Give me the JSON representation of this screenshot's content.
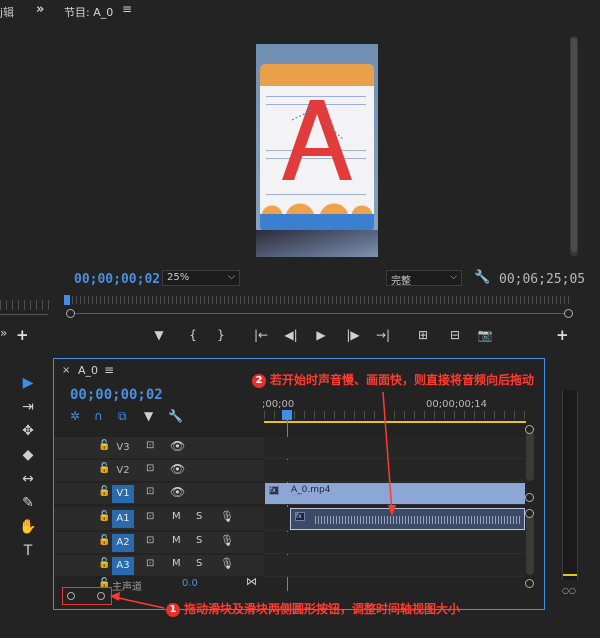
{
  "source_panel": {
    "tab_fragment": "j辑",
    "chevron": "»",
    "plus": "+",
    "chevron_small": "»"
  },
  "program_monitor": {
    "title": "节目: A_0",
    "menu_icon": "menu-icon",
    "timecode_current": "00;00;00;02",
    "zoom_select": "25%",
    "quality_select": "完整",
    "timecode_duration": "00;06;25;05",
    "controls": [
      "marker-icon",
      "in-point-icon",
      "out-point-icon",
      "go-to-in-icon",
      "step-back-icon",
      "play-icon",
      "step-forward-icon",
      "go-to-out-icon",
      "lift-icon",
      "extract-icon",
      "export-frame-icon"
    ],
    "control_glyphs": [
      "▼",
      "{",
      "}",
      "|←",
      "◀|",
      "▶",
      "|▶",
      "→|",
      "⊞",
      "⊟",
      "📷"
    ],
    "plus": "+"
  },
  "tools": [
    {
      "name": "selection-tool-icon",
      "glyph": "▶",
      "active": true
    },
    {
      "name": "track-select-tool-icon",
      "glyph": "⇥",
      "active": false
    },
    {
      "name": "ripple-edit-tool-icon",
      "glyph": "✥",
      "active": false
    },
    {
      "name": "razor-tool-icon",
      "glyph": "◆",
      "active": false
    },
    {
      "name": "slip-tool-icon",
      "glyph": "↔",
      "active": false
    },
    {
      "name": "pen-tool-icon",
      "glyph": "✎",
      "active": false
    },
    {
      "name": "hand-tool-icon",
      "glyph": "✋",
      "active": false
    },
    {
      "name": "type-tool-icon",
      "glyph": "T",
      "active": false
    }
  ],
  "timeline": {
    "close": "×",
    "title": "A_0",
    "menu": "≡",
    "timecode": "00;00;00;02",
    "ruler_labels": [
      ";00;00",
      "00;00;00;14"
    ],
    "tracks": [
      {
        "name": "V3",
        "type": "video",
        "targeted": false
      },
      {
        "name": "V2",
        "type": "video",
        "targeted": false
      },
      {
        "name": "V1",
        "type": "video",
        "targeted": true
      },
      {
        "name": "A1",
        "type": "audio",
        "targeted": true
      },
      {
        "name": "A2",
        "type": "audio",
        "targeted": true
      },
      {
        "name": "A3",
        "type": "audio",
        "targeted": true
      }
    ],
    "mute_label": "M",
    "solo_label": "S",
    "video_clip_label": "A_0.mp4",
    "fx_badge": "fx",
    "master_label": "主声道",
    "master_value": "0.0"
  },
  "annotations": {
    "a1_number": "1",
    "a1_text": "拖动滑块及滑块两侧圆形按钮，调整时间轴视图大小",
    "a2_number": "2",
    "a2_text": "若开始时声音慢、画面快，则直接将音频向后拖动"
  },
  "colors": {
    "accent": "#3f8ee8",
    "timecode": "#4a90e2",
    "annotation": "#ff3b2f",
    "in_out_bar": "#e6c41e",
    "video_clip": "#8ca7d6",
    "audio_clip": "#3d4a66"
  }
}
